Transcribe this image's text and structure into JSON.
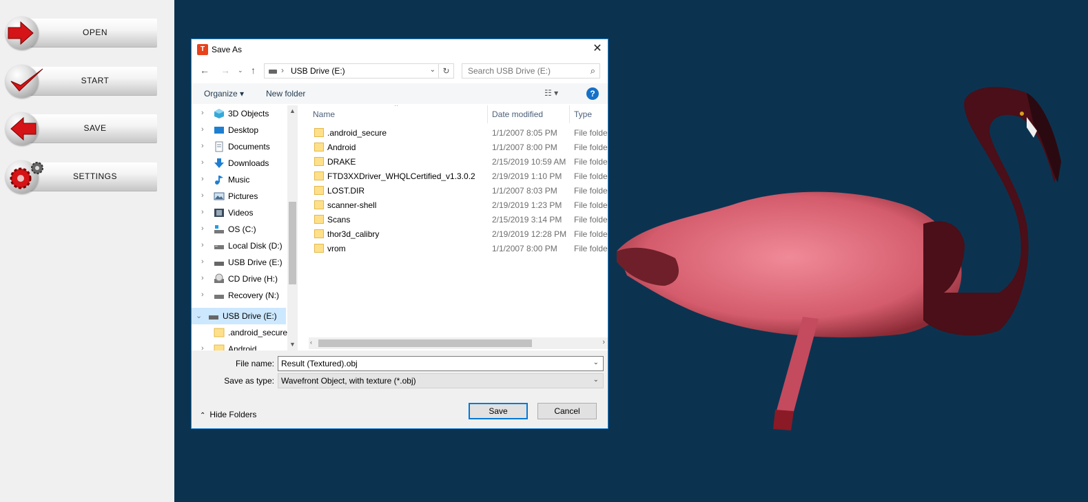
{
  "sidebar": {
    "buttons": [
      {
        "label": "OPEN",
        "icon": "arrow-right-icon"
      },
      {
        "label": "START",
        "icon": "checkmark-icon"
      },
      {
        "label": "SAVE",
        "icon": "arrow-left-icon"
      },
      {
        "label": "SETTINGS",
        "icon": "gears-icon"
      }
    ]
  },
  "dialog": {
    "title": "Save As",
    "close": "✕",
    "address": {
      "path": "USB Drive (E:)",
      "separator": "›"
    },
    "search_placeholder": "Search USB Drive (E:)",
    "toolbar": {
      "organize": "Organize ▾",
      "new_folder": "New folder",
      "help": "?"
    },
    "nav_tree": [
      {
        "label": "3D Objects",
        "icon": "3d-objects-icon"
      },
      {
        "label": "Desktop",
        "icon": "desktop-icon"
      },
      {
        "label": "Documents",
        "icon": "documents-icon"
      },
      {
        "label": "Downloads",
        "icon": "downloads-icon"
      },
      {
        "label": "Music",
        "icon": "music-icon"
      },
      {
        "label": "Pictures",
        "icon": "pictures-icon"
      },
      {
        "label": "Videos",
        "icon": "videos-icon"
      },
      {
        "label": "OS (C:)",
        "icon": "os-drive-icon"
      },
      {
        "label": "Local Disk (D:)",
        "icon": "drive-icon"
      },
      {
        "label": "USB Drive (E:)",
        "icon": "usb-drive-icon"
      },
      {
        "label": "CD Drive (H:)",
        "icon": "cd-drive-icon"
      },
      {
        "label": "Recovery (N:)",
        "icon": "drive-icon"
      },
      {
        "label": "USB Drive (E:)",
        "icon": "usb-drive-icon",
        "selected": true
      },
      {
        "label": ".android_secure",
        "icon": "folder-icon"
      },
      {
        "label": "Android",
        "icon": "folder-icon"
      }
    ],
    "columns": {
      "name": "Name",
      "date": "Date modified",
      "type": "Type"
    },
    "files": [
      {
        "name": ".android_secure",
        "date": "1/1/2007 8:05 PM",
        "type": "File folder"
      },
      {
        "name": "Android",
        "date": "1/1/2007 8:00 PM",
        "type": "File folder"
      },
      {
        "name": "DRAKE",
        "date": "2/15/2019 10:59 AM",
        "type": "File folder"
      },
      {
        "name": "FTD3XXDriver_WHQLCertified_v1.3.0.2",
        "date": "2/19/2019 1:10 PM",
        "type": "File folder"
      },
      {
        "name": "LOST.DIR",
        "date": "1/1/2007 8:03 PM",
        "type": "File folder"
      },
      {
        "name": "scanner-shell",
        "date": "2/19/2019 1:23 PM",
        "type": "File folder"
      },
      {
        "name": "Scans",
        "date": "2/15/2019 3:14 PM",
        "type": "File folder"
      },
      {
        "name": "thor3d_calibry",
        "date": "2/19/2019 12:28 PM",
        "type": "File folder"
      },
      {
        "name": "vrom",
        "date": "1/1/2007 8:00 PM",
        "type": "File folder"
      }
    ],
    "file_name_label": "File name:",
    "file_name_value": "Result (Textured).obj",
    "save_type_label": "Save as type:",
    "save_type_value": "Wavefront Object, with texture (*.obj)",
    "hide_folders": "Hide Folders",
    "save_button": "Save",
    "cancel_button": "Cancel"
  },
  "colors": {
    "viewport_bg": "#0b3350",
    "sidebar_bg": "#f0f0f0",
    "accent": "#0078d7",
    "selection": "#cce8ff"
  }
}
